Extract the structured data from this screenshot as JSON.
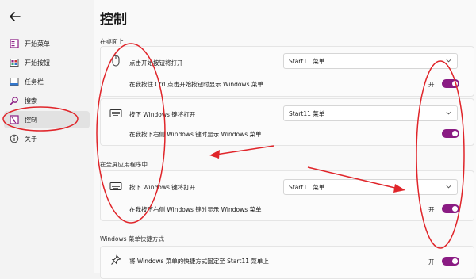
{
  "nav": {
    "back_label": "←",
    "items": [
      {
        "label": "开始菜单",
        "icon": "start-menu-icon"
      },
      {
        "label": "开始按钮",
        "icon": "start-button-icon"
      },
      {
        "label": "任务栏",
        "icon": "taskbar-icon"
      },
      {
        "label": "搜索",
        "icon": "search-icon"
      },
      {
        "label": "控制",
        "icon": "control-icon"
      },
      {
        "label": "关于",
        "icon": "info-icon"
      }
    ],
    "active_index": 4
  },
  "page": {
    "title": "控制"
  },
  "sections": {
    "desktop": "在桌面上",
    "fullscreen": "在全屏应用程序中",
    "shortcut": "Windows 菜单快捷方式"
  },
  "card1": {
    "label": "点击开始按钮将打开",
    "dropdown": "Start11 菜单",
    "sub_label": "在我按住 Ctrl 点击开始按钮时显示 Windows 菜单",
    "toggle_label": "开",
    "toggle_on": true
  },
  "card2": {
    "label": "按下 Windows 键将打开",
    "dropdown": "Start11 菜单",
    "sub_label": "在我按下右侧 Windows 键时显示 Windows 菜单",
    "toggle_label": "开",
    "toggle_on": true
  },
  "card3": {
    "label": "按下 Windows 键将打开",
    "dropdown": "Start11 菜单",
    "sub_label": "在我按下右侧 Windows 键时显示 Windows 菜单",
    "toggle_label": "开",
    "toggle_on": true
  },
  "card4": {
    "label": "将 Windows 菜单的快捷方式固定至 Start11 菜单上",
    "toggle_label": "开",
    "toggle_on": true
  },
  "colors": {
    "accent": "#8a1b83",
    "annotation": "#e0252a"
  }
}
